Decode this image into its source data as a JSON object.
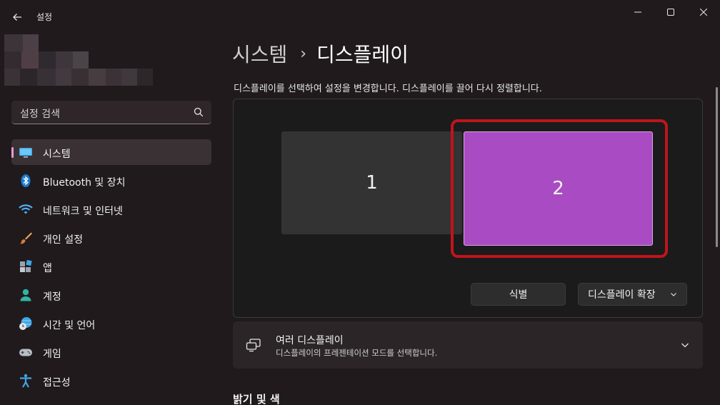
{
  "window": {
    "app_title": "설정",
    "back_icon": "back-arrow-icon",
    "minimize_icon": "minimize-icon",
    "maximize_icon": "maximize-icon",
    "close_icon": "close-icon"
  },
  "search": {
    "placeholder": "설정 검색",
    "icon": "search-icon"
  },
  "sidebar": {
    "items": [
      {
        "label": "시스템",
        "icon": "system-monitor-icon",
        "active": true
      },
      {
        "label": "Bluetooth 및 장치",
        "icon": "bluetooth-icon",
        "active": false
      },
      {
        "label": "네트워크 및 인터넷",
        "icon": "wifi-icon",
        "active": false
      },
      {
        "label": "개인 설정",
        "icon": "brush-icon",
        "active": false
      },
      {
        "label": "앱",
        "icon": "apps-icon",
        "active": false
      },
      {
        "label": "계정",
        "icon": "account-icon",
        "active": false
      },
      {
        "label": "시간 및 언어",
        "icon": "globe-clock-icon",
        "active": false
      },
      {
        "label": "게임",
        "icon": "gamepad-icon",
        "active": false
      },
      {
        "label": "접근성",
        "icon": "accessibility-icon",
        "active": false
      }
    ]
  },
  "main": {
    "breadcrumb_parent": "시스템",
    "breadcrumb_separator": "›",
    "breadcrumb_current": "디스플레이",
    "instruction": "디스플레이를 선택하여 설정을 변경합니다. 디스플레이를 끌어 다시 정렬합니다.",
    "monitors": [
      {
        "label": "1",
        "selected": false
      },
      {
        "label": "2",
        "selected": true
      }
    ],
    "identify_button": "식별",
    "mode_dropdown": "디스플레이 확장",
    "multi_display": {
      "title": "여러 디스플레이",
      "description": "디스플레이의 프레젠테이션 모드를 선택합니다."
    },
    "section_brightness": "밝기 및 색"
  },
  "colors": {
    "background": "#201a1d",
    "accent_indicator": "#e89bd6",
    "selected_monitor": "#a94bc2",
    "highlight_box": "#c0141c"
  }
}
